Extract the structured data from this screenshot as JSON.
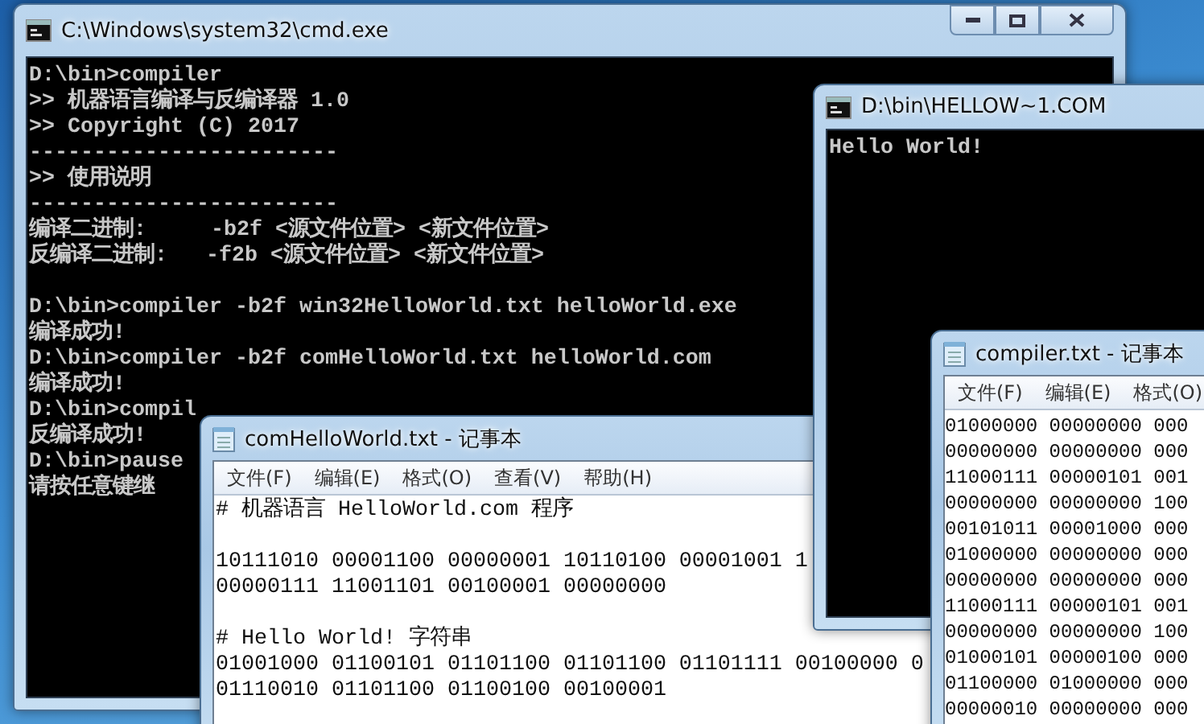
{
  "windows": [
    {
      "kind": "console",
      "title": "C:\\Windows\\system32\\cmd.exe",
      "caption_buttons": true,
      "blocks": [
        [
          "D:\\bin>compiler",
          ">> 机器语言编译与反编译器 1.0",
          ">> Copyright (C) 2017",
          "------------------------",
          ">> 使用说明",
          "------------------------",
          "编译二进制:     -b2f <源文件位置> <新文件位置>",
          "反编译二进制:   -f2b <源文件位置> <新文件位置>"
        ],
        [
          "D:\\bin>compiler -b2f win32HelloWorld.txt helloWorld.exe",
          "编译成功!",
          "D:\\bin>compiler -b2f comHelloWorld.txt helloWorld.com",
          "编译成功!",
          "D:\\bin>compil",
          "反编译成功!",
          "D:\\bin>pause",
          "请按任意键继"
        ]
      ]
    },
    {
      "kind": "notepad",
      "title": "comHelloWorld.txt - 记事本",
      "menu": [
        "文件(F)",
        "编辑(E)",
        "格式(O)",
        "查看(V)",
        "帮助(H)"
      ],
      "blocks": [
        [
          "# 机器语言 HelloWorld.com 程序"
        ],
        [
          "10111010 00001100 00000001 10110100 00001001 1",
          "00000111 11001101 00100001 00000000"
        ],
        [
          "# Hello World! 字符串",
          "01001000 01100101 01101100 01101100 01101111 00100000 0",
          "01110010 01101100 01100100 00100001"
        ]
      ]
    },
    {
      "kind": "console",
      "title": "D:\\bin\\HELLOW~1.COM",
      "caption_buttons": false,
      "blocks": [
        [
          "Hello World!"
        ]
      ]
    },
    {
      "kind": "notepad",
      "title": "compiler.txt - 记事本",
      "menu": [
        "文件(F)",
        "编辑(E)",
        "格式(O)"
      ],
      "blocks": [
        [
          "01000000 00000000 000",
          "00000000 00000000 000",
          "11000111 00000101 001",
          "00000000 00000000 100",
          "00101011 00001000 000",
          "01000000 00000000 000",
          "00000000 00000000 000",
          "11000111 00000101 001",
          "00000000 00000000 100",
          "01000101 00000100 000",
          "01100000 01000000 000",
          "00000010 00000000 000"
        ]
      ]
    }
  ]
}
